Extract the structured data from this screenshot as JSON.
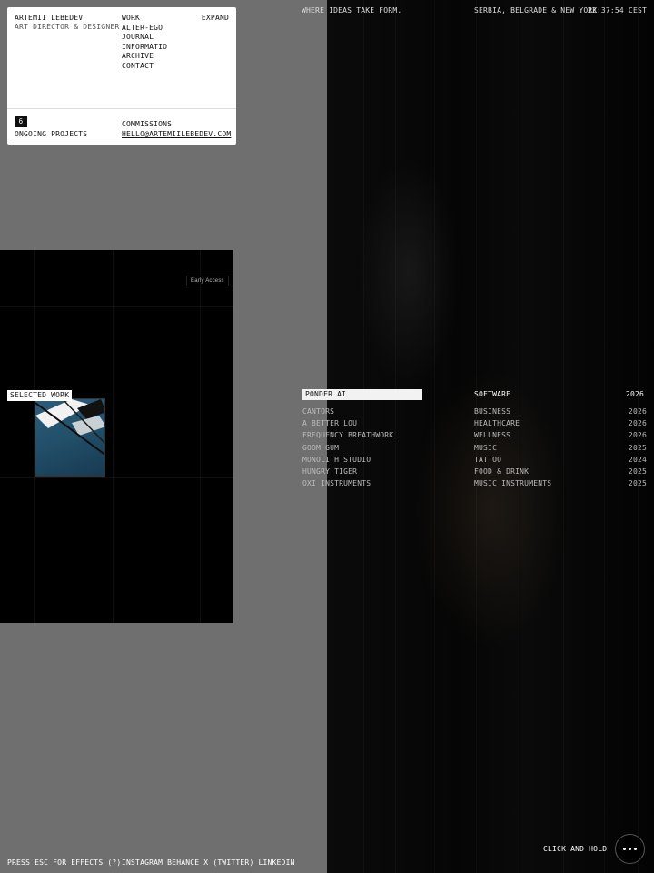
{
  "card": {
    "name": "ARTEMII LEBEDEV",
    "role": "ART DIRECTOR & DESIGNER",
    "nav": [
      "WORK",
      "ALTER-EGO",
      "JOURNAL",
      "INFORMATIO",
      "ARCHIVE",
      "CONTACT"
    ],
    "expand": "EXPAND",
    "projects_count": "6",
    "ongoing_label": "ONGOING PROJECTS",
    "commissions_label": "COMMISSIONS",
    "email": "HELLO@ARTEMIILEBEDEV.COM"
  },
  "header": {
    "tagline": "WHERE IDEAS TAKE FORM.",
    "location": "SERBIA, BELGRADE & NEW YORK",
    "clock": "22:37:54 CEST"
  },
  "preview": {
    "badge": "Early Access",
    "selected_work_label": "SELECTED WORK"
  },
  "projects": [
    {
      "name": "PONDER AI",
      "category": "SOFTWARE",
      "year": "2026",
      "active": true
    },
    {
      "name": "CANTORS",
      "category": "BUSINESS",
      "year": "2026"
    },
    {
      "name": "A BETTER LOU",
      "category": "HEALTHCARE",
      "year": "2026"
    },
    {
      "name": "FREQUENCY BREATHWORK",
      "category": "WELLNESS",
      "year": "2026"
    },
    {
      "name": "GOOM GUM",
      "category": "MUSIC",
      "year": "2025"
    },
    {
      "name": "MONOLITH STUDIO",
      "category": "TATTOO",
      "year": "2024"
    },
    {
      "name": "HUNGRY TIGER",
      "category": "FOOD & DRINK",
      "year": "2025"
    },
    {
      "name": "OXI INSTRUMENTS",
      "category": "MUSIC INSTRUMENTS",
      "year": "2025"
    }
  ],
  "footer": {
    "esc_hint": "PRESS ESC FOR EFFECTS (?)",
    "links": [
      "INSTAGRAM",
      "BEHANCE",
      "X (TWITTER)",
      "LINKEDIN"
    ],
    "click_hold": "CLICK AND HOLD"
  },
  "icons": {
    "menu": "more-dots-icon"
  },
  "colors": {
    "left_bg": "#6f6f6f",
    "right_bg": "#050505",
    "card_bg": "#ffffff",
    "thumb": "#2c5e7c"
  }
}
